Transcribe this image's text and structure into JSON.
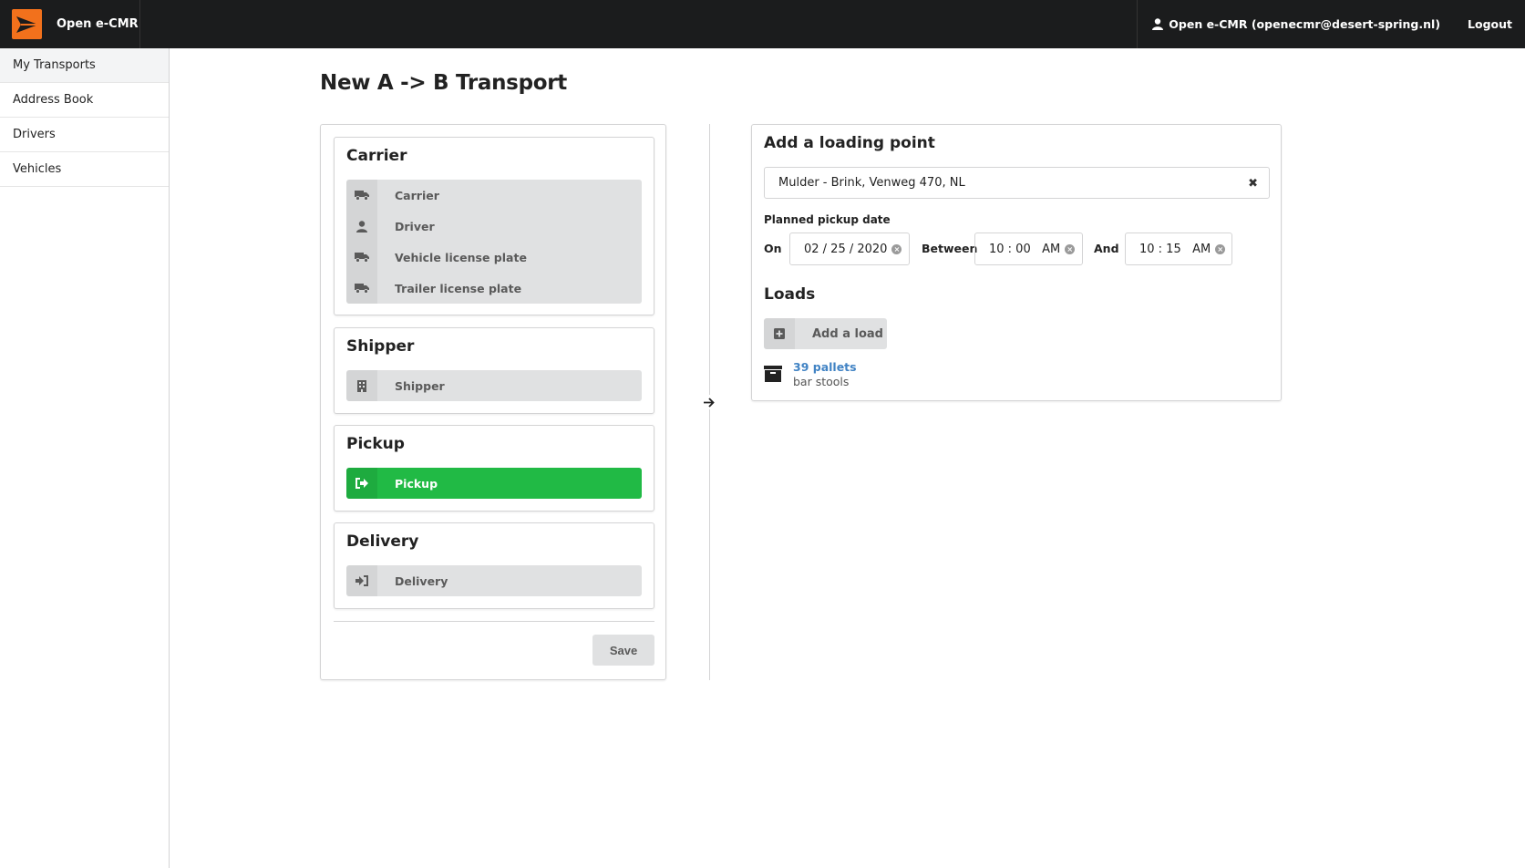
{
  "app": {
    "name": "Open e-CMR"
  },
  "header": {
    "user_label": "Open e-CMR (openecmr@desert-spring.nl)",
    "logout_label": "Logout"
  },
  "sidebar": {
    "items": [
      {
        "label": "My Transports"
      },
      {
        "label": "Address Book"
      },
      {
        "label": "Drivers"
      },
      {
        "label": "Vehicles"
      }
    ]
  },
  "page": {
    "title": "New A -> B Transport"
  },
  "carrier_card": {
    "title": "Carrier",
    "fields": [
      {
        "label": "Carrier",
        "icon": "truck-icon"
      },
      {
        "label": "Driver",
        "icon": "user-icon"
      },
      {
        "label": "Vehicle license plate",
        "icon": "truck-icon"
      },
      {
        "label": "Trailer license plate",
        "icon": "truck-icon"
      }
    ]
  },
  "shipper_card": {
    "title": "Shipper",
    "field_label": "Shipper",
    "icon": "building-icon"
  },
  "pickup_card": {
    "title": "Pickup",
    "field_label": "Pickup",
    "icon": "sign-out-icon",
    "color": "#21ba45"
  },
  "delivery_card": {
    "title": "Delivery",
    "field_label": "Delivery",
    "icon": "sign-in-icon"
  },
  "save_label": "Save",
  "loading_point": {
    "title": "Add a loading point",
    "address_value": "Mulder - Brink, Venweg 470, NL",
    "planned_pickup_label": "Planned pickup date",
    "on_label": "On",
    "date_value": "02 / 25 / 2020",
    "between_label": "Between",
    "time_from": "10 : 00   AM",
    "and_label": "And",
    "time_to": "10 : 15   AM",
    "loads_title": "Loads",
    "add_load_label": "Add a load",
    "loads": [
      {
        "quantity": "39 pallets",
        "description": "bar stools"
      }
    ]
  },
  "colors": {
    "accent": "#f2711c",
    "link": "#4183c4",
    "success": "#21ba45",
    "topbar": "#1b1c1d"
  }
}
